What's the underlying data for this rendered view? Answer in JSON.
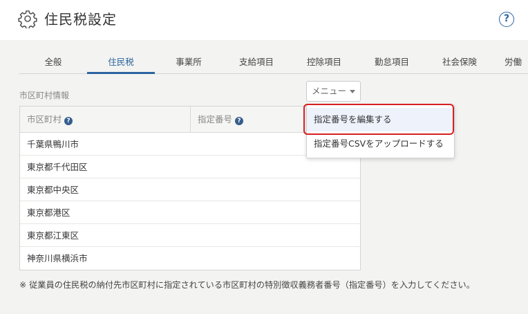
{
  "header": {
    "title": "住民税設定",
    "help_label": "?"
  },
  "tabs": [
    {
      "label": "全般"
    },
    {
      "label": "住民税"
    },
    {
      "label": "事業所"
    },
    {
      "label": "支給項目"
    },
    {
      "label": "控除項目"
    },
    {
      "label": "勤怠項目"
    },
    {
      "label": "社会保険"
    },
    {
      "label": "労働"
    }
  ],
  "section": {
    "label": "市区町村情報"
  },
  "menu": {
    "label": "メニュー",
    "items": [
      {
        "label": "指定番号を編集する"
      },
      {
        "label": "指定番号CSVをアップロードする"
      }
    ]
  },
  "table": {
    "headers": [
      {
        "label": "市区町村"
      },
      {
        "label": "指定番号"
      }
    ],
    "rows": [
      {
        "city": "千葉県鴨川市",
        "number": ""
      },
      {
        "city": "東京都千代田区",
        "number": ""
      },
      {
        "city": "東京都中央区",
        "number": ""
      },
      {
        "city": "東京都港区",
        "number": ""
      },
      {
        "city": "東京都江東区",
        "number": ""
      },
      {
        "city": "神奈川県横浜市",
        "number": ""
      }
    ]
  },
  "note": "※ 従業員の住民税の納付先市区町村に指定されている市区町村の特別徴収義務者番号（指定番号）を入力してください。",
  "colors": {
    "accent": "#2b64a0",
    "highlight": "#d62020",
    "background": "#f3f3f1"
  }
}
